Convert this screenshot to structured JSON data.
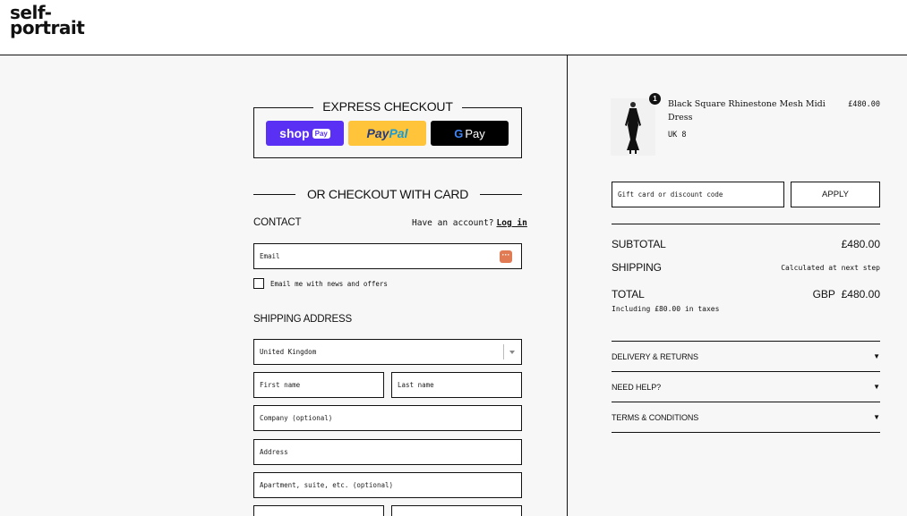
{
  "brand": {
    "line1": "self-",
    "line2": "portrait"
  },
  "express": {
    "title": "EXPRESS CHECKOUT",
    "shop_label": "shop",
    "shop_pill": "Pay",
    "paypal_a": "Pay",
    "paypal_b": "Pal",
    "gpay_g": "G",
    "gpay_label": "Pay"
  },
  "or_card": "OR CHECKOUT WITH CARD",
  "contact": {
    "label": "CONTACT",
    "have_account": "Have an account?",
    "login": "Log in",
    "email_placeholder": "Email",
    "newsletter": "Email me with news and offers"
  },
  "shipping": {
    "label": "SHIPPING ADDRESS",
    "country": "United Kingdom",
    "first_name": "First name",
    "last_name": "Last name",
    "company": "Company (optional)",
    "address": "Address",
    "apartment": "Apartment, suite, etc. (optional)"
  },
  "order": {
    "qty": "1",
    "name": "Black Square Rhinestone Mesh Midi Dress",
    "size": "UK 8",
    "price": "£480.00",
    "discount_placeholder": "Gift card or discount code",
    "apply": "APPLY",
    "subtotal_label": "SUBTOTAL",
    "subtotal": "£480.00",
    "shipping_label": "SHIPPING",
    "shipping_note": "Calculated at next step",
    "total_label": "TOTAL",
    "currency": "GBP",
    "total": "£480.00",
    "tax_note": "Including £80.00 in taxes"
  },
  "accordions": [
    {
      "label": "DELIVERY & RETURNS"
    },
    {
      "label": "NEED HELP?"
    },
    {
      "label": "TERMS & CONDITIONS"
    }
  ],
  "colors": {
    "shop": "#5a31f4",
    "paypal": "#ffc439",
    "gpay": "#000000",
    "accent": "#e07b53"
  }
}
